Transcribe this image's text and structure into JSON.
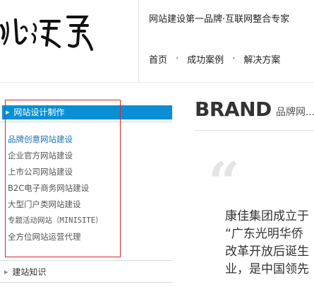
{
  "header": {
    "tagline": "网站建设第一品牌·互联网整合专家",
    "nav": [
      "首页",
      "成功案例",
      "解决方案"
    ],
    "nav_separator": "·"
  },
  "sidebar": {
    "section_title": "网站设计制作",
    "items": [
      {
        "label": "品牌创意网站建设",
        "active": true
      },
      {
        "label": "企业官方网站建设"
      },
      {
        "label": "上市公司网站建设"
      },
      {
        "label": "B2C电子商务网站建设"
      },
      {
        "label": "大型门户类网站建设"
      },
      {
        "label": "专题活动网站（MINISITE）"
      },
      {
        "label": "全方位网站运营代理"
      }
    ],
    "knowledge_title": "建站知识",
    "accent_color": "#0a8fd4",
    "highlight_border_color": "#d9262b"
  },
  "main": {
    "brand_title": "BRAND",
    "brand_subtitle": "品牌网...",
    "quote_mark": "“",
    "paragraph_lines": [
      "康佳集团成立于",
      "“广东光明华侨",
      "改革开放后诞生",
      "业，是中国领先"
    ]
  }
}
